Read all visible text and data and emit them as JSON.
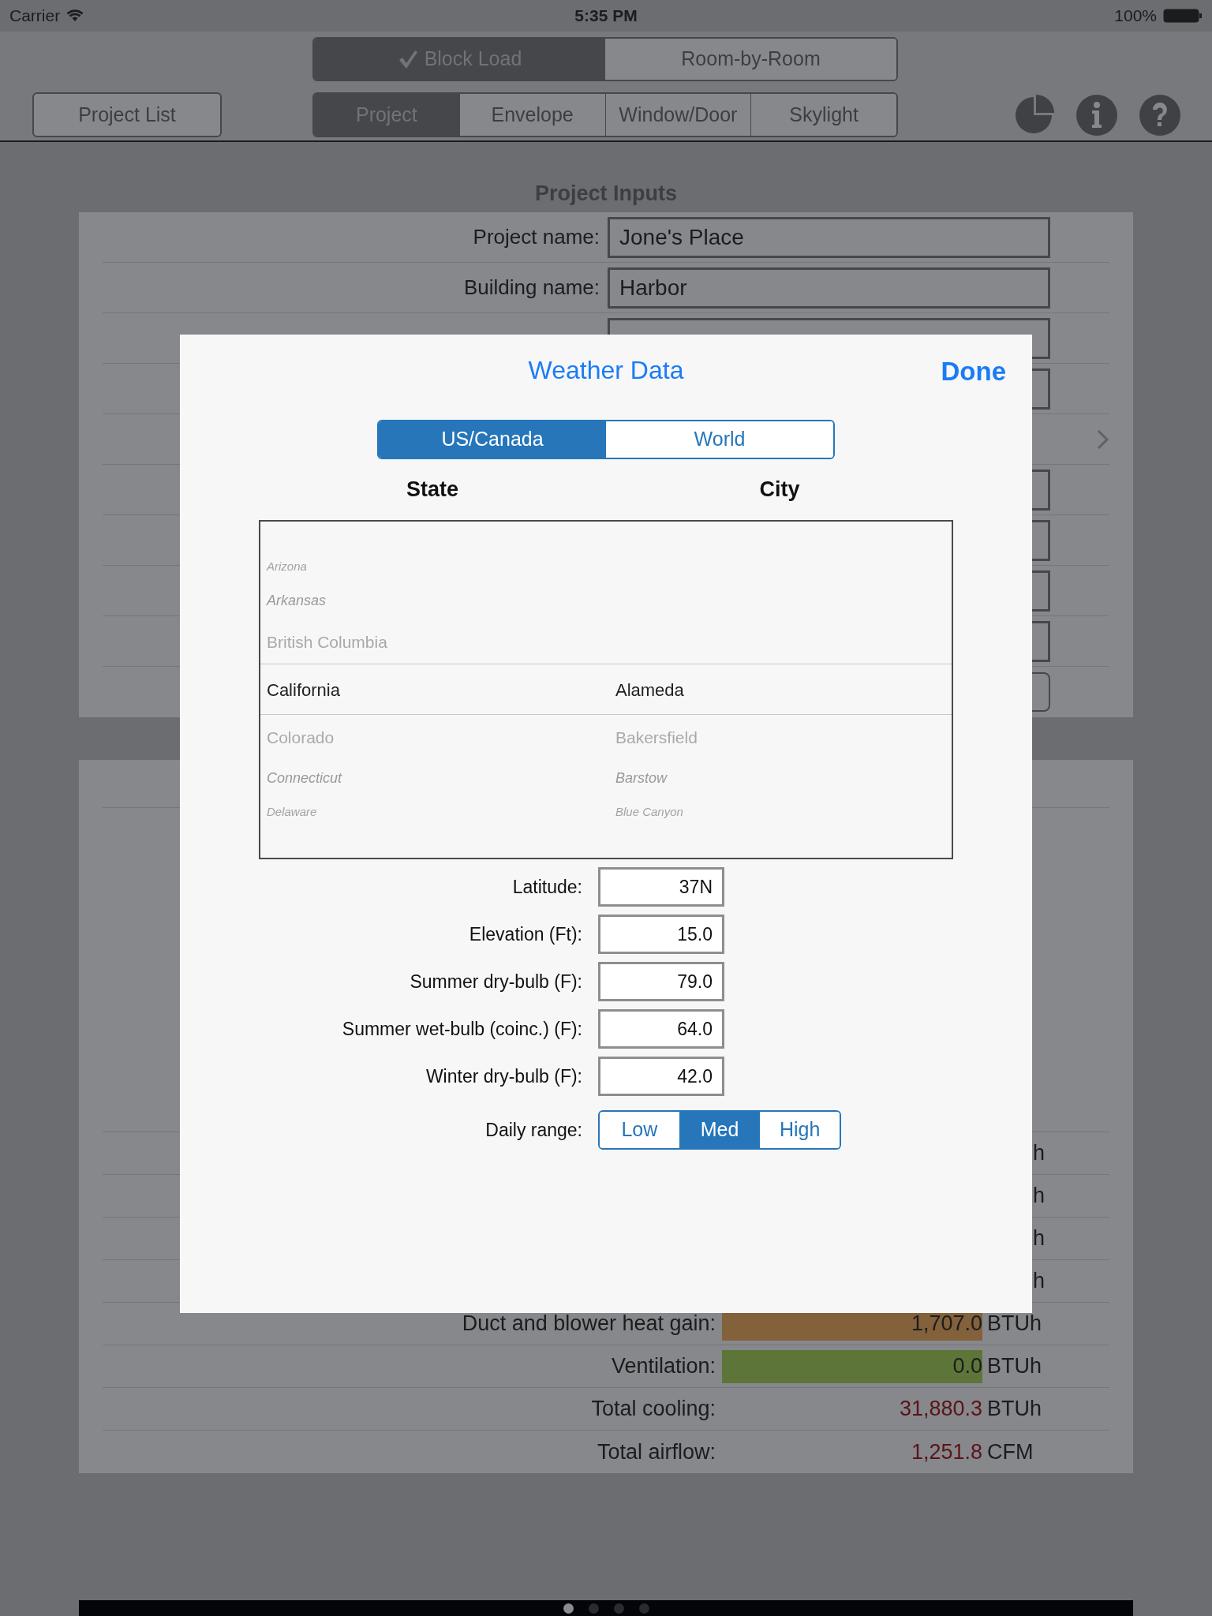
{
  "status_bar": {
    "carrier": "Carrier",
    "time": "5:35 PM",
    "battery": "100%"
  },
  "mode_tabs": [
    {
      "label": "Block Load",
      "selected": true
    },
    {
      "label": "Room-by-Room",
      "selected": false
    }
  ],
  "project_list_button": "Project List",
  "section_tabs": [
    {
      "label": "Project",
      "selected": true
    },
    {
      "label": "Envelope",
      "selected": false
    },
    {
      "label": "Window/Door",
      "selected": false
    },
    {
      "label": "Skylight",
      "selected": false
    }
  ],
  "inputs": {
    "title": "Project Inputs",
    "rows": [
      {
        "kind": "field",
        "label": "Project name:",
        "value": "Jone's Place"
      },
      {
        "kind": "field",
        "label": "Building name:",
        "value": "Harbor"
      },
      {
        "kind": "field"
      },
      {
        "kind": "field"
      },
      {
        "kind": "link"
      },
      {
        "kind": "field"
      },
      {
        "kind": "field"
      },
      {
        "kind": "field"
      },
      {
        "kind": "field"
      },
      {
        "kind": "rounded_field"
      }
    ]
  },
  "results": [
    {
      "unit": "h"
    },
    {
      "unit": "h"
    },
    {
      "unit": "h"
    },
    {
      "unit": "h"
    },
    {
      "label": "Duct and blower heat gain:",
      "value": "1,707.0",
      "unit": "BTUh",
      "kind": "bar",
      "color": "#83613a"
    },
    {
      "label": "Ventilation:",
      "value": "0.0",
      "unit": "BTUh",
      "kind": "bar",
      "color": "#5e753a"
    },
    {
      "label": "Total cooling:",
      "value": "31,880.3",
      "unit": "BTUh",
      "kind": "total"
    },
    {
      "label": "Total airflow:",
      "value": "1,251.8",
      "unit": "CFM",
      "kind": "total"
    }
  ],
  "page_dots": [
    {
      "selected": true
    },
    {
      "selected": false
    },
    {
      "selected": false
    },
    {
      "selected": false
    }
  ],
  "modal": {
    "title": "Weather Data",
    "done": "Done",
    "region_tabs": [
      {
        "label": "US/Canada",
        "selected": true
      },
      {
        "label": "World",
        "selected": false
      }
    ],
    "state_header": "State",
    "city_header": "City",
    "states": [
      {
        "label": "Arizona",
        "selected": false
      },
      {
        "label": "Arkansas",
        "selected": false
      },
      {
        "label": "British Columbia",
        "selected": false
      },
      {
        "label": "California",
        "selected": true
      },
      {
        "label": "Colorado",
        "selected": false
      },
      {
        "label": "Connecticut",
        "selected": false
      },
      {
        "label": "Delaware",
        "selected": false
      }
    ],
    "cities": [
      {
        "label": "Alameda",
        "selected": true
      },
      {
        "label": "Bakersfield",
        "selected": false
      },
      {
        "label": "Barstow",
        "selected": false
      },
      {
        "label": "Blue Canyon",
        "selected": false
      }
    ],
    "fields": [
      {
        "label": "Latitude:",
        "value": "37N"
      },
      {
        "label": "Elevation (Ft):",
        "value": "15.0"
      },
      {
        "label": "Summer dry-bulb (F):",
        "value": "79.0"
      },
      {
        "label": "Summer wet-bulb (coinc.) (F):",
        "value": "64.0"
      },
      {
        "label": "Winter dry-bulb (F):",
        "value": "42.0"
      }
    ],
    "daily_range": {
      "label": "Daily range:",
      "options": [
        {
          "label": "Low",
          "selected": false
        },
        {
          "label": "Med",
          "selected": true
        },
        {
          "label": "High",
          "selected": false
        }
      ]
    }
  }
}
